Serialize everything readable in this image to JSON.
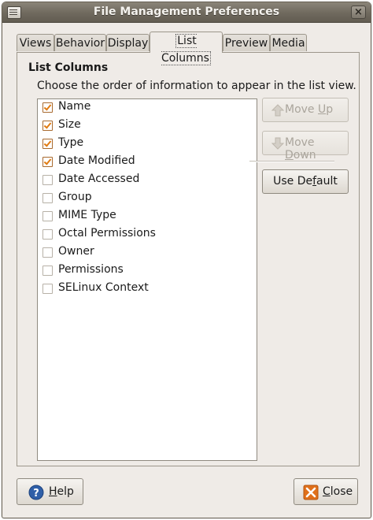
{
  "window": {
    "title": "File Management Preferences"
  },
  "tabs": [
    {
      "label": "Views",
      "active": false
    },
    {
      "label": "Behavior",
      "active": false
    },
    {
      "label": "Display",
      "active": false
    },
    {
      "label": "List Columns",
      "active": true
    },
    {
      "label": "Preview",
      "active": false
    },
    {
      "label": "Media",
      "active": false
    }
  ],
  "section": {
    "title": "List Columns",
    "description": "Choose the order of information to appear in the list view."
  },
  "columns": [
    {
      "label": "Name",
      "checked": true
    },
    {
      "label": "Size",
      "checked": true
    },
    {
      "label": "Type",
      "checked": true
    },
    {
      "label": "Date Modified",
      "checked": true
    },
    {
      "label": "Date Accessed",
      "checked": false
    },
    {
      "label": "Group",
      "checked": false
    },
    {
      "label": "MIME Type",
      "checked": false
    },
    {
      "label": "Octal Permissions",
      "checked": false
    },
    {
      "label": "Owner",
      "checked": false
    },
    {
      "label": "Permissions",
      "checked": false
    },
    {
      "label": "SELinux Context",
      "checked": false
    }
  ],
  "buttons": {
    "move_up": {
      "pre": "Move ",
      "mnemonic": "U",
      "post": "p",
      "enabled": false,
      "icon": "arrow-up-icon"
    },
    "move_down": {
      "pre": "Move ",
      "mnemonic": "D",
      "post": "own",
      "enabled": false,
      "icon": "arrow-down-icon"
    },
    "use_default": {
      "pre": "Use De",
      "mnemonic": "f",
      "post": "ault",
      "enabled": true
    },
    "help": {
      "pre": "",
      "mnemonic": "H",
      "post": "elp",
      "icon": "help-icon"
    },
    "close": {
      "pre": "",
      "mnemonic": "C",
      "post": "lose",
      "icon": "close-icon"
    }
  },
  "colors": {
    "check": "#e07b12",
    "titlebar": "#6f695e",
    "help_icon": "#2f5fa8",
    "close_icon": "#e0701a"
  }
}
